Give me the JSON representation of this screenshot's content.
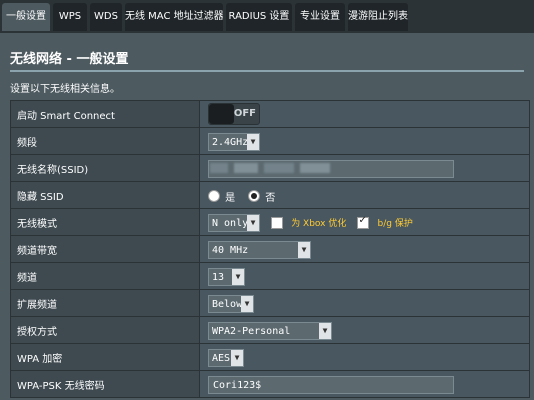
{
  "tabs": [
    {
      "label": "一般设置",
      "active": true
    },
    {
      "label": "WPS",
      "active": false
    },
    {
      "label": "WDS",
      "active": false
    },
    {
      "label": "无线 MAC 地址过滤器",
      "active": false
    },
    {
      "label": "RADIUS 设置",
      "active": false
    },
    {
      "label": "专业设置",
      "active": false
    },
    {
      "label": "漫游阻止列表",
      "active": false
    }
  ],
  "page": {
    "title": "无线网络 - 一般设置",
    "description": "设置以下无线相关信息。"
  },
  "rows": {
    "smart_connect": {
      "label": "启动 Smart Connect",
      "state": "OFF"
    },
    "band": {
      "label": "频段",
      "value": "2.4GHz"
    },
    "ssid": {
      "label": "无线名称(SSID)",
      "value": ""
    },
    "hide_ssid": {
      "label": "隐藏 SSID",
      "opt_yes": "是",
      "opt_no": "否",
      "selected": "否"
    },
    "mode": {
      "label": "无线模式",
      "value": "N only",
      "xbox_label": "为 Xbox 优化",
      "xbox_checked": false,
      "bg_label": "b/g 保护",
      "bg_checked": true
    },
    "bandwidth": {
      "label": "频道带宽",
      "value": "40 MHz"
    },
    "channel": {
      "label": "频道",
      "value": "13"
    },
    "ext_channel": {
      "label": "扩展频道",
      "value": "Below"
    },
    "auth": {
      "label": "授权方式",
      "value": "WPA2-Personal"
    },
    "wpa_encryption": {
      "label": "WPA 加密",
      "value": "AES"
    },
    "wpa_psk": {
      "label": "WPA-PSK 无线密码",
      "value": "Cori123$"
    }
  },
  "colors": {
    "background": "#2b3336",
    "panel": "#4d5a60",
    "label_cell": "#3e4a50",
    "value_cell": "#495760",
    "accent_yellow": "#ffcc33"
  }
}
